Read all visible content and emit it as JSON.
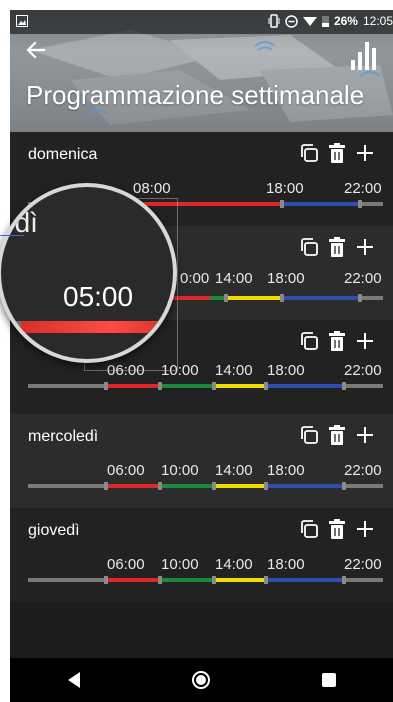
{
  "status": {
    "battery": "26%",
    "time": "12:05"
  },
  "header": {
    "title": "Programmazione settimanale",
    "back_icon": "arrow-left-icon",
    "stats_icon": "bar-chart-icon"
  },
  "colors": {
    "red": "#e0282b",
    "green": "#1c8a3a",
    "yellow": "#f2dc00",
    "blue": "#2f4fb0",
    "gray": "#7a7a7a"
  },
  "days": [
    {
      "name": "domenica",
      "times": [
        "08:00",
        "18:00",
        "22:00"
      ]
    },
    {
      "name": "",
      "times": [
        "0:00",
        "14:00",
        "18:00",
        "22:00"
      ]
    },
    {
      "name": "",
      "times": [
        "06:00",
        "10:00",
        "14:00",
        "18:00",
        "22:00"
      ]
    },
    {
      "name": "mercoledì",
      "times": [
        "06:00",
        "10:00",
        "14:00",
        "18:00",
        "22:00"
      ]
    },
    {
      "name": "giovedì",
      "times": [
        "06:00",
        "10:00",
        "14:00",
        "18:00",
        "22:00"
      ]
    }
  ],
  "magnifier": {
    "day": "edì",
    "time": "05:00"
  },
  "icons": {
    "copy": "copy-icon",
    "delete": "trash-icon",
    "add": "plus-icon"
  }
}
